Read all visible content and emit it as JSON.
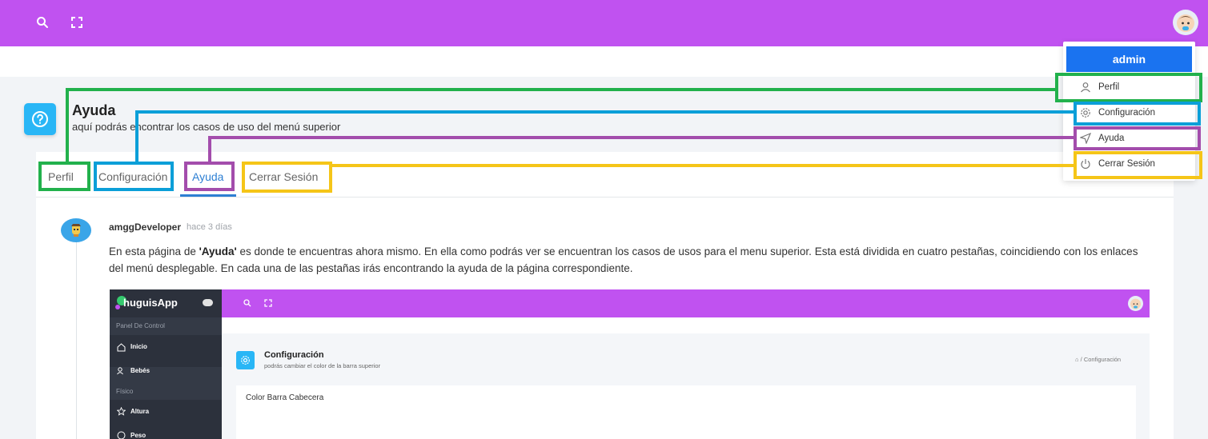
{
  "topbar": {
    "search_icon": "search-icon",
    "fullscreen_icon": "expand-icon",
    "color": "#c052f0"
  },
  "page": {
    "title": "Ayuda",
    "subtitle": "aquí podrás encontrar los casos de uso del menú superior",
    "icon": "question-icon"
  },
  "tabs": [
    {
      "label": "Perfil"
    },
    {
      "label": "Configuración"
    },
    {
      "label": "Ayuda"
    },
    {
      "label": "Cerrar Sesión"
    }
  ],
  "post": {
    "author": "amggDeveloper",
    "time_ago": "hace 3 días",
    "text_part1": "En esta página de ",
    "text_bold": "'Ayuda'",
    "text_part2": " es donde te encuentras ahora mismo. En ella como podrás ver se encuentran los casos de usos para el menu superior. Esta está dividida en cuatro pestañas, coincidiendo con los enlaces del menú desplegable. En cada una de las pestañas irás encontrando la ayuda de la página correspondiente."
  },
  "screenshot": {
    "app_name": "huguisApp",
    "section1": "Panel De Control",
    "item_inicio": "Inicio",
    "item_bebes": "Bebés",
    "section2": "Físico",
    "item_altura": "Altura",
    "item_peso": "Peso",
    "title": "Configuración",
    "subtitle": "podrás cambiar el color de la barra superior",
    "breadcrumb": "Configuración",
    "breadcrumb_separator": "/",
    "card_label": "Color Barra Cabecera"
  },
  "dropdown": {
    "header": "admin",
    "header_color": "#1a73f0",
    "items": [
      {
        "label": "Perfil",
        "icon": "user-icon"
      },
      {
        "label": "Configuración",
        "icon": "gear-icon"
      },
      {
        "label": "Ayuda",
        "icon": "navigation-icon"
      },
      {
        "label": "Cerrar Sesión",
        "icon": "power-icon"
      }
    ]
  },
  "annotation_colors": {
    "perfil": "#22b14c",
    "configuracion": "#0b9fd8",
    "ayuda": "#a34dac",
    "cerrar_sesion": "#f5c518"
  }
}
